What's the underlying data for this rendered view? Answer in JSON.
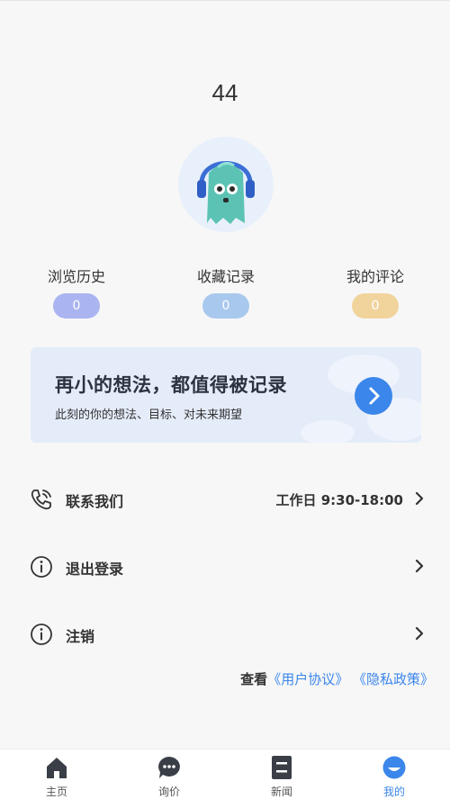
{
  "profile": {
    "username": "44"
  },
  "stats": [
    {
      "label": "浏览历史",
      "count": "0",
      "color": "#aab4f0"
    },
    {
      "label": "收藏记录",
      "count": "0",
      "color": "#a9c8ee"
    },
    {
      "label": "我的评论",
      "count": "0",
      "color": "#f1d39c"
    }
  ],
  "banner": {
    "title": "再小的想法，都值得被记录",
    "subtitle": "此刻的你的想法、目标、对未来期望",
    "accent": "#3b86ea"
  },
  "menu": {
    "contact": {
      "label": "联系我们",
      "value": "工作日 9:30-18:00",
      "icon": "phone-icon"
    },
    "logout": {
      "label": "退出登录",
      "icon": "info-icon"
    },
    "cancel": {
      "label": "注销",
      "icon": "info-icon"
    }
  },
  "policy": {
    "view": "查看",
    "user_agreement": "《用户协议》",
    "privacy_policy": "《隐私政策》"
  },
  "tabbar": {
    "home": "主页",
    "inquiry": "询价",
    "news": "新闻",
    "mine": "我的",
    "active": "mine"
  }
}
